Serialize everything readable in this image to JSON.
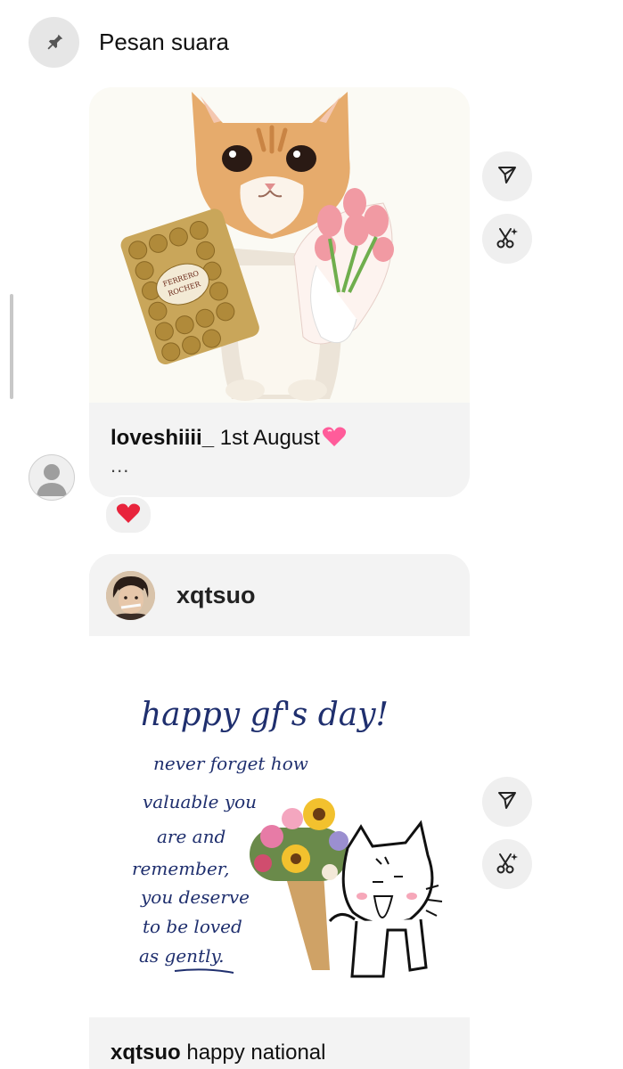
{
  "header": {
    "title": "Pesan suara",
    "pin_icon": "pin-icon"
  },
  "messages": [
    {
      "caption_user": "loveshiiii_",
      "caption_text": " 1st August",
      "caption_emoji": "pink-heart",
      "ellipsis": "...",
      "reaction": "red-heart"
    },
    {
      "user": "xqtsuo",
      "note_lines": [
        "happy gf's day!",
        "never forget how",
        "valuable you",
        "are and",
        "remember,",
        "you deserve",
        "to be loved",
        "as gently."
      ],
      "caption_user": "xqtsuo",
      "caption_text": " happy national"
    }
  ],
  "actions": {
    "share_icon": "send-icon",
    "remix_icon": "scissors-sparkle-icon"
  },
  "colors": {
    "card_bg": "#f3f3f3",
    "heart": "#e8243c",
    "pink_heart": "#ff5c9a",
    "ink": "#1f2f6e"
  }
}
